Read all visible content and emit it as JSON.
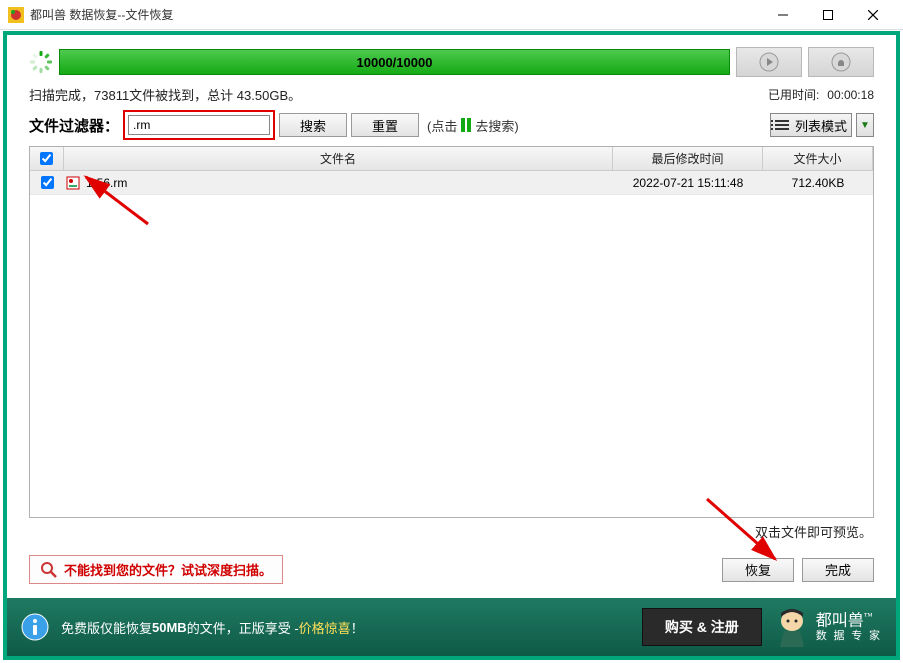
{
  "window": {
    "title": "都叫兽 数据恢复--文件恢复"
  },
  "progress": {
    "text": "10000/10000"
  },
  "status": {
    "scan_result": "扫描完成，73811文件被找到，总计 43.50GB。",
    "elapsed_label": "已用时间:",
    "elapsed_value": "00:00:18"
  },
  "filter": {
    "label": "文件过滤器：",
    "value": ".rm",
    "search_btn": "搜索",
    "reset_btn": "重置",
    "click_hint_prefix": "(点击",
    "click_hint_suffix": "去搜索)"
  },
  "view_mode": {
    "label": "列表模式"
  },
  "table": {
    "headers": {
      "name": "文件名",
      "date": "最后修改时间",
      "size": "文件大小"
    },
    "rows": [
      {
        "name": "1-56.rm",
        "date": "2022-07-21 15:11:48",
        "size": "712.40KB"
      }
    ]
  },
  "preview_hint": "双击文件即可预览。",
  "deep_scan": {
    "text": "不能找到您的文件？试试深度扫描。"
  },
  "actions": {
    "recover": "恢复",
    "done": "完成"
  },
  "footer": {
    "text_prefix": "免费版仅能恢复",
    "text_bold": "50MB",
    "text_mid": "的文件，正版享受 - ",
    "text_highlight": "价格惊喜",
    "text_suffix": "！",
    "buy_btn": "购买 & 注册",
    "brand_name": "都叫兽",
    "brand_sub": "数 据 专 家",
    "brand_tm": "™"
  }
}
